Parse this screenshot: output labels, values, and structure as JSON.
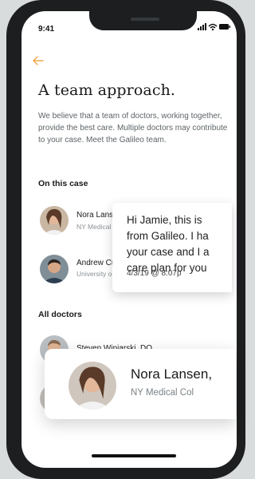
{
  "status": {
    "time": "9:41"
  },
  "header": {
    "title": "A team approach."
  },
  "intro": "We believe that a team of doctors, working together, provide the best care. Multiple doctors may contribute to your case. Meet the Galileo team.",
  "sections": {
    "on_this_case": "On this case",
    "all_doctors": "All doctors"
  },
  "case_doctors": [
    {
      "name": "Nora Lanse",
      "institution": "NY Medical"
    },
    {
      "name": "Andrew Cu",
      "institution": "University o"
    }
  ],
  "all_doctors": [
    {
      "name": "Steven Winiarski, DO"
    }
  ],
  "message": {
    "text": "Hi Jamie, this is\nfrom Galileo. I ha\nyour case and I a\ncare plan for you",
    "timestamp": "4/3/19 @ 8:07p"
  },
  "profile_card": {
    "name": "Nora Lansen,",
    "institution": "NY Medical Col"
  },
  "colors": {
    "accent": "#f0a64a",
    "text": "#1a1a1a",
    "muted": "#8a9095"
  }
}
